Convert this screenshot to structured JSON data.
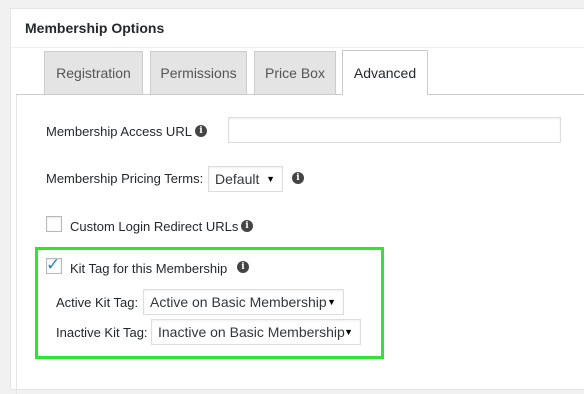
{
  "panel": {
    "title": "Membership Options"
  },
  "tabs": [
    {
      "label": "Registration",
      "active": false
    },
    {
      "label": "Permissions",
      "active": false
    },
    {
      "label": "Price Box",
      "active": false
    },
    {
      "label": "Advanced",
      "active": true
    }
  ],
  "fields": {
    "access_url": {
      "label": "Membership Access URL",
      "value": ""
    },
    "pricing_terms": {
      "label": "Membership Pricing Terms:",
      "selected": "Default"
    },
    "custom_login": {
      "label": "Custom Login Redirect URLs",
      "checked": false
    },
    "kit_tag": {
      "label": "Kit Tag for this Membership",
      "checked": true
    },
    "active_kit_tag": {
      "label": "Active Kit Tag:",
      "selected": "Active on Basic Membership"
    },
    "inactive_kit_tag": {
      "label": "Inactive Kit Tag:",
      "selected": "Inactive on Basic Membership"
    }
  },
  "icons": {
    "info": "info-icon",
    "checkmark": "checkmark-icon",
    "dropdown": "dropdown-arrow-icon"
  },
  "colors": {
    "highlight_border": "#2ee62e",
    "checkbox_check": "#1e8cbe",
    "info_icon": "#444444"
  }
}
